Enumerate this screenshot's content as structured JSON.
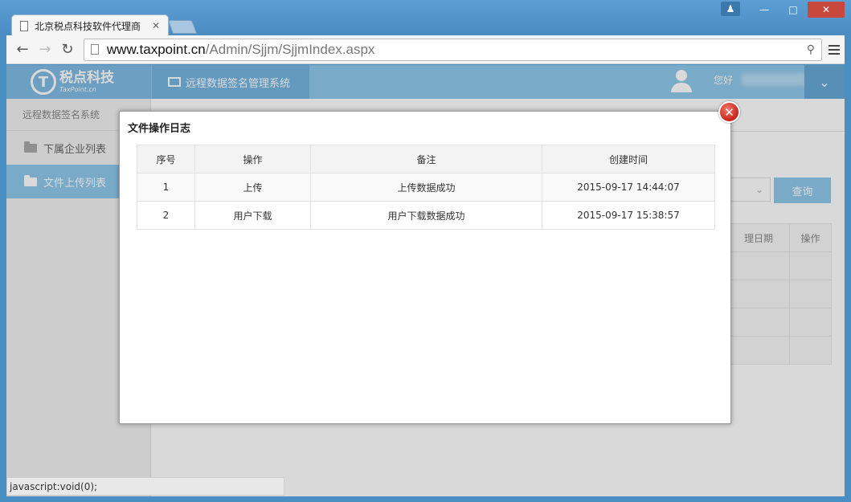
{
  "browser": {
    "tab_title": "北京税点科技软件代理商",
    "tab_close": "✕",
    "url_host": "www.taxpoint.cn",
    "url_path": "/Admin/Sjjm/SjjmIndex.aspx",
    "status_text": "javascript:void(0);"
  },
  "header": {
    "logo_mark": "T",
    "logo_cn": "税点科技",
    "logo_en": "TaxPoint.cn",
    "system_tab": "远程数据签名管理系统",
    "greeting": "您好"
  },
  "sidebar": {
    "heading": "远程数据签名系统",
    "items": [
      {
        "label": "下属企业列表",
        "active": false
      },
      {
        "label": "文件上传列表",
        "active": true
      }
    ]
  },
  "background": {
    "query_button": "查询",
    "col_date": "理日期",
    "col_action": "操作"
  },
  "modal": {
    "title": "文件操作日志",
    "columns": [
      "序号",
      "操作",
      "备注",
      "创建时间"
    ],
    "rows": [
      {
        "no": "1",
        "action": "上传",
        "note": "上传数据成功",
        "created": "2015-09-17 14:44:07"
      },
      {
        "no": "2",
        "action": "用户下载",
        "note": "用户下载数据成功",
        "created": "2015-09-17 15:38:57"
      }
    ]
  },
  "colors": {
    "header_blue": "#8fc8ec",
    "close_red": "#c8231a"
  }
}
